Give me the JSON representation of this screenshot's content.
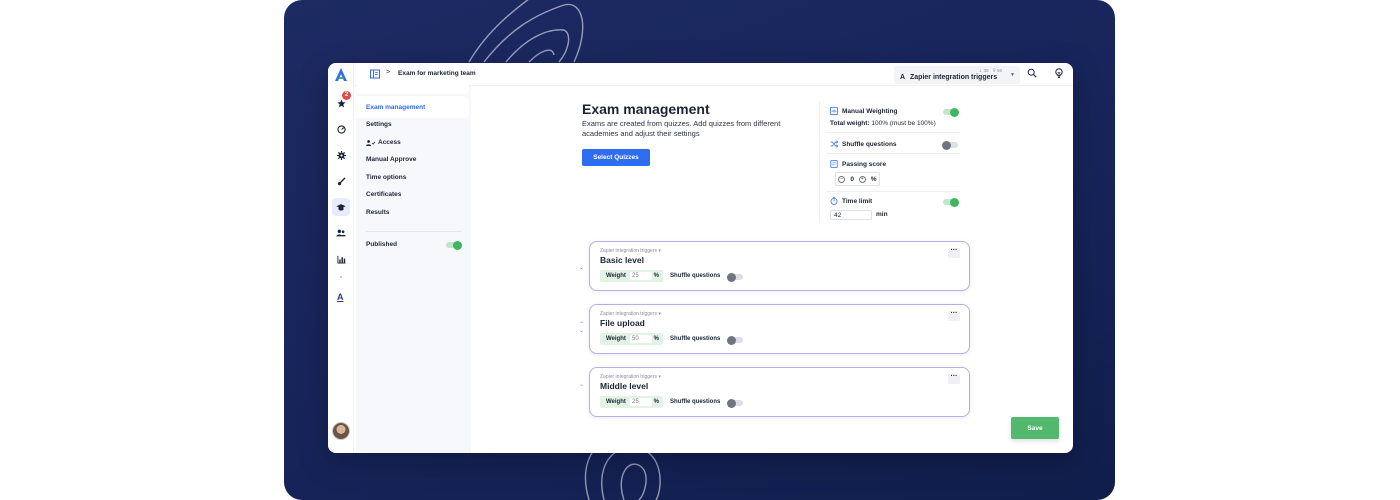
{
  "breadcrumb": {
    "separator": ">",
    "current": "Exam for marketing team"
  },
  "topbar": {
    "selector_label": "Zapier integration triggers",
    "selector_stat_1": "38",
    "selector_stat_2": "56",
    "selector_icon": "A"
  },
  "rail": {
    "notification_count": "2",
    "bottom_logo": "A",
    "icons": [
      "star-icon",
      "gauge-icon",
      "gear-icon",
      "brush-icon",
      "graduation-cap-icon",
      "users-icon",
      "bar-chart-icon"
    ]
  },
  "menu": {
    "items": [
      "Exam management",
      "Settings",
      "Access",
      "Manual Approve",
      "Time options",
      "Certificates",
      "Results"
    ],
    "published_label": "Published",
    "published_on": true
  },
  "main": {
    "title": "Exam management",
    "description": "Exams are created from quizzes. Add quizzes from different academies and adjust their settings",
    "select_button": "Select Quizzes",
    "save_button": "Save"
  },
  "options": {
    "manual_weighting_label": "Manual Weighting",
    "manual_weighting_on": true,
    "total_weight_label": "Total weight:",
    "total_weight_value": "100% (must be 100%)",
    "shuffle_label": "Shuffle questions",
    "shuffle_on": false,
    "passing_label": "Passing score",
    "passing_value": "0",
    "passing_unit": "%",
    "stepper_minus": "−",
    "stepper_plus": "+",
    "time_limit_label": "Time limit",
    "time_limit_on": true,
    "time_limit_value": "42",
    "time_limit_unit": "min"
  },
  "quizzes": [
    {
      "source": "Zapier integration triggers ▾",
      "name": "Basic level",
      "weight_label": "Weight",
      "weight": "25",
      "unit": "%",
      "shuffle_label": "Shuffle questions",
      "more": "···"
    },
    {
      "source": "Zapier integration triggers ▾",
      "name": "File upload",
      "weight_label": "Weight",
      "weight": "50",
      "unit": "%",
      "shuffle_label": "Shuffle questions",
      "more": "···"
    },
    {
      "source": "Zapier integration triggers ▾",
      "name": "Middle level",
      "weight_label": "Weight",
      "weight": "25",
      "unit": "%",
      "shuffle_label": "Shuffle questions",
      "more": "···"
    }
  ],
  "colors": {
    "accent": "#2f6df0",
    "success": "#52b86e",
    "background": "#16245a",
    "card_border": "#b8aee6"
  }
}
